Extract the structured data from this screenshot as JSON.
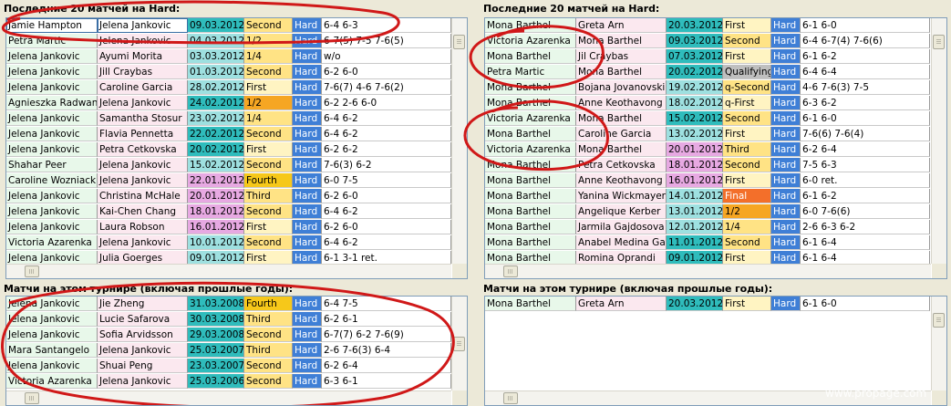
{
  "panels": [
    {
      "title": "Последние 20 матчей на Hard:",
      "rows": [
        {
          "p1": "Jamie Hampton",
          "p2": "Jelena Jankovic",
          "date": "09.03.2012",
          "round": "Second",
          "surface": "Hard",
          "score": "6-4 6-3",
          "c1": "#ffffff",
          "c2": "#ffffff",
          "cd": "#2fbcbc",
          "cr": "#ffe385"
        },
        {
          "p1": "Petra Martic",
          "p2": "Jelena Jankovic",
          "date": "04.03.2012",
          "round": "1/2",
          "surface": "Hard",
          "score": "6-7(5) 7-5 7-6(5)",
          "c1": "#e8f8ea",
          "c2": "#fbe8ef",
          "cd": "#9ee0e0",
          "cr": "#ffe385"
        },
        {
          "p1": "Jelena Jankovic",
          "p2": "Ayumi Morita",
          "date": "03.03.2012",
          "round": "1/4",
          "surface": "Hard",
          "score": "w/o",
          "c1": "#e8f8ea",
          "c2": "#fbe8ef",
          "cd": "#9ee0e0",
          "cr": "#ffe385"
        },
        {
          "p1": "Jelena Jankovic",
          "p2": "Jill Craybas",
          "date": "01.03.2012",
          "round": "Second",
          "surface": "Hard",
          "score": "6-2 6-0",
          "c1": "#e8f8ea",
          "c2": "#fbe8ef",
          "cd": "#9ee0e0",
          "cr": "#ffe385"
        },
        {
          "p1": "Jelena Jankovic",
          "p2": "Caroline Garcia",
          "date": "28.02.2012",
          "round": "First",
          "surface": "Hard",
          "score": "7-6(7) 4-6 7-6(2)",
          "c1": "#e8f8ea",
          "c2": "#fbe8ef",
          "cd": "#9ee0e0",
          "cr": "#fff4c2"
        },
        {
          "p1": "Agnieszka Radwans",
          "p2": "Jelena Jankovic",
          "date": "24.02.2012",
          "round": "1/2",
          "surface": "Hard",
          "score": "6-2 2-6 6-0",
          "c1": "#e8f8ea",
          "c2": "#fbe8ef",
          "cd": "#2fbcbc",
          "cr": "#f6a623"
        },
        {
          "p1": "Jelena Jankovic",
          "p2": "Samantha Stosur",
          "date": "23.02.2012",
          "round": "1/4",
          "surface": "Hard",
          "score": "6-4 6-2",
          "c1": "#e8f8ea",
          "c2": "#fbe8ef",
          "cd": "#9ee0e0",
          "cr": "#ffe385"
        },
        {
          "p1": "Jelena Jankovic",
          "p2": "Flavia Pennetta",
          "date": "22.02.2012",
          "round": "Second",
          "surface": "Hard",
          "score": "6-4 6-2",
          "c1": "#e8f8ea",
          "c2": "#fbe8ef",
          "cd": "#2fbcbc",
          "cr": "#ffe385"
        },
        {
          "p1": "Jelena Jankovic",
          "p2": "Petra Cetkovska",
          "date": "20.02.2012",
          "round": "First",
          "surface": "Hard",
          "score": "6-2 6-2",
          "c1": "#e8f8ea",
          "c2": "#fbe8ef",
          "cd": "#2fbcbc",
          "cr": "#fff4c2"
        },
        {
          "p1": "Shahar Peer",
          "p2": "Jelena Jankovic",
          "date": "15.02.2012",
          "round": "Second",
          "surface": "Hard",
          "score": "7-6(3) 6-2",
          "c1": "#e8f8ea",
          "c2": "#fbe8ef",
          "cd": "#9ee0e0",
          "cr": "#ffe385"
        },
        {
          "p1": "Caroline Wozniacki",
          "p2": "Jelena Jankovic",
          "date": "22.01.2012",
          "round": "Fourth",
          "surface": "Hard",
          "score": "6-0 7-5",
          "c1": "#e8f8ea",
          "c2": "#fbe8ef",
          "cd": "#e7a9e2",
          "cr": "#f6c81a"
        },
        {
          "p1": "Jelena Jankovic",
          "p2": "Christina McHale",
          "date": "20.01.2012",
          "round": "Third",
          "surface": "Hard",
          "score": "6-2 6-0",
          "c1": "#e8f8ea",
          "c2": "#fbe8ef",
          "cd": "#e7a9e2",
          "cr": "#ffe385"
        },
        {
          "p1": "Jelena Jankovic",
          "p2": "Kai-Chen Chang",
          "date": "18.01.2012",
          "round": "Second",
          "surface": "Hard",
          "score": "6-4 6-2",
          "c1": "#e8f8ea",
          "c2": "#fbe8ef",
          "cd": "#e7a9e2",
          "cr": "#ffe385"
        },
        {
          "p1": "Jelena Jankovic",
          "p2": "Laura Robson",
          "date": "16.01.2012",
          "round": "First",
          "surface": "Hard",
          "score": "6-2 6-0",
          "c1": "#e8f8ea",
          "c2": "#fbe8ef",
          "cd": "#e7a9e2",
          "cr": "#fff4c2"
        },
        {
          "p1": "Victoria Azarenka",
          "p2": "Jelena Jankovic",
          "date": "10.01.2012",
          "round": "Second",
          "surface": "Hard",
          "score": "6-4 6-2",
          "c1": "#e8f8ea",
          "c2": "#fbe8ef",
          "cd": "#9ee0e0",
          "cr": "#ffe385"
        },
        {
          "p1": "Jelena Jankovic",
          "p2": "Julia Goerges",
          "date": "09.01.2012",
          "round": "First",
          "surface": "Hard",
          "score": "6-1 3-1 ret.",
          "c1": "#e8f8ea",
          "c2": "#fbe8ef",
          "cd": "#9ee0e0",
          "cr": "#fff4c2"
        }
      ]
    },
    {
      "title": "Последние 20 матчей на Hard:",
      "rows": [
        {
          "p1": "Mona Barthel",
          "p2": "Greta Arn",
          "date": "20.03.2012",
          "round": "First",
          "surface": "Hard",
          "score": "6-1 6-0",
          "c1": "#e8f8ea",
          "c2": "#fbe8ef",
          "cd": "#2fbcbc",
          "cr": "#fff4c2"
        },
        {
          "p1": "Victoria Azarenka",
          "p2": "Mona Barthel",
          "date": "09.03.2012",
          "round": "Second",
          "surface": "Hard",
          "score": "6-4 6-7(4) 7-6(6)",
          "c1": "#e8f8ea",
          "c2": "#fbe8ef",
          "cd": "#2fbcbc",
          "cr": "#ffe385"
        },
        {
          "p1": "Mona Barthel",
          "p2": "Jil Craybas",
          "date": "07.03.2012",
          "round": "First",
          "surface": "Hard",
          "score": "6-1 6-2",
          "c1": "#e8f8ea",
          "c2": "#fbe8ef",
          "cd": "#2fbcbc",
          "cr": "#fff4c2"
        },
        {
          "p1": "Petra Martic",
          "p2": "Mona Barthel",
          "date": "20.02.2012",
          "round": "Qualifying",
          "surface": "Hard",
          "score": "6-4 6-4",
          "c1": "#e8f8ea",
          "c2": "#fbe8ef",
          "cd": "#2fbcbc",
          "cr": "#bfbfbf"
        },
        {
          "p1": "Mona Barthel",
          "p2": "Bojana Jovanovski",
          "date": "19.02.2012",
          "round": "q-Second",
          "surface": "Hard",
          "score": "4-6 7-6(3) 7-5",
          "c1": "#e8f8ea",
          "c2": "#fbe8ef",
          "cd": "#9ee0e0",
          "cr": "#ffe385"
        },
        {
          "p1": "Mona Barthel",
          "p2": "Anne Keothavong",
          "date": "18.02.2012",
          "round": "q-First",
          "surface": "Hard",
          "score": "6-3 6-2",
          "c1": "#e8f8ea",
          "c2": "#fbe8ef",
          "cd": "#9ee0e0",
          "cr": "#fff4c2"
        },
        {
          "p1": "Victoria Azarenka",
          "p2": "Mona Barthel",
          "date": "15.02.2012",
          "round": "Second",
          "surface": "Hard",
          "score": "6-1 6-0",
          "c1": "#e8f8ea",
          "c2": "#fbe8ef",
          "cd": "#2fbcbc",
          "cr": "#ffe385"
        },
        {
          "p1": "Mona Barthel",
          "p2": "Caroline Garcia",
          "date": "13.02.2012",
          "round": "First",
          "surface": "Hard",
          "score": "7-6(6) 7-6(4)",
          "c1": "#e8f8ea",
          "c2": "#fbe8ef",
          "cd": "#9ee0e0",
          "cr": "#fff4c2"
        },
        {
          "p1": "Victoria Azarenka",
          "p2": "Mona Barthel",
          "date": "20.01.2012",
          "round": "Third",
          "surface": "Hard",
          "score": "6-2 6-4",
          "c1": "#e8f8ea",
          "c2": "#fbe8ef",
          "cd": "#e7a9e2",
          "cr": "#ffe385"
        },
        {
          "p1": "Mona Barthel",
          "p2": "Petra Cetkovska",
          "date": "18.01.2012",
          "round": "Second",
          "surface": "Hard",
          "score": "7-5 6-3",
          "c1": "#e8f8ea",
          "c2": "#fbe8ef",
          "cd": "#e7a9e2",
          "cr": "#ffe385"
        },
        {
          "p1": "Mona Barthel",
          "p2": "Anne Keothavong",
          "date": "16.01.2012",
          "round": "First",
          "surface": "Hard",
          "score": "6-0 ret.",
          "c1": "#e8f8ea",
          "c2": "#fbe8ef",
          "cd": "#e7a9e2",
          "cr": "#fff4c2"
        },
        {
          "p1": "Mona Barthel",
          "p2": "Yanina Wickmayer",
          "date": "14.01.2012",
          "round": "Final",
          "surface": "Hard",
          "score": "6-1 6-2",
          "c1": "#e8f8ea",
          "c2": "#fbe8ef",
          "cd": "#9ee0e0",
          "cr": "#f36f2a"
        },
        {
          "p1": "Mona Barthel",
          "p2": "Angelique Kerber",
          "date": "13.01.2012",
          "round": "1/2",
          "surface": "Hard",
          "score": "6-0 7-6(6)",
          "c1": "#e8f8ea",
          "c2": "#fbe8ef",
          "cd": "#9ee0e0",
          "cr": "#f6a623"
        },
        {
          "p1": "Mona Barthel",
          "p2": "Jarmila Gajdosova",
          "date": "12.01.2012",
          "round": "1/4",
          "surface": "Hard",
          "score": "2-6 6-3 6-2",
          "c1": "#e8f8ea",
          "c2": "#fbe8ef",
          "cd": "#9ee0e0",
          "cr": "#ffe385"
        },
        {
          "p1": "Mona Barthel",
          "p2": "Anabel Medina Garri",
          "date": "11.01.2012",
          "round": "Second",
          "surface": "Hard",
          "score": "6-1 6-4",
          "c1": "#e8f8ea",
          "c2": "#fbe8ef",
          "cd": "#2fbcbc",
          "cr": "#ffe385"
        },
        {
          "p1": "Mona Barthel",
          "p2": "Romina Oprandi",
          "date": "09.01.2012",
          "round": "First",
          "surface": "Hard",
          "score": "6-1 6-4",
          "c1": "#e8f8ea",
          "c2": "#fbe8ef",
          "cd": "#2fbcbc",
          "cr": "#fff4c2"
        }
      ]
    },
    {
      "title": "Матчи на этом турнире (включая прошлые годы):",
      "rows": [
        {
          "p1": "Jelena Jankovic",
          "p2": "Jie Zheng",
          "date": "31.03.2008",
          "round": "Fourth",
          "surface": "Hard",
          "score": "6-4 7-5",
          "c1": "#e8f8ea",
          "c2": "#fbe8ef",
          "cd": "#2fbcbc",
          "cr": "#f6c81a"
        },
        {
          "p1": "Jelena Jankovic",
          "p2": "Lucie Safarova",
          "date": "30.03.2008",
          "round": "Third",
          "surface": "Hard",
          "score": "6-2 6-1",
          "c1": "#e8f8ea",
          "c2": "#fbe8ef",
          "cd": "#2fbcbc",
          "cr": "#ffe385"
        },
        {
          "p1": "Jelena Jankovic",
          "p2": "Sofia Arvidsson",
          "date": "29.03.2008",
          "round": "Second",
          "surface": "Hard",
          "score": "6-7(7) 6-2 7-6(9)",
          "c1": "#e8f8ea",
          "c2": "#fbe8ef",
          "cd": "#2fbcbc",
          "cr": "#ffe385"
        },
        {
          "p1": "Mara Santangelo",
          "p2": "Jelena Jankovic",
          "date": "25.03.2007",
          "round": "Third",
          "surface": "Hard",
          "score": "2-6 7-6(3) 6-4",
          "c1": "#e8f8ea",
          "c2": "#fbe8ef",
          "cd": "#2fbcbc",
          "cr": "#ffe385"
        },
        {
          "p1": "Jelena Jankovic",
          "p2": "Shuai Peng",
          "date": "23.03.2007",
          "round": "Second",
          "surface": "Hard",
          "score": "6-2 6-4",
          "c1": "#e8f8ea",
          "c2": "#fbe8ef",
          "cd": "#2fbcbc",
          "cr": "#ffe385"
        },
        {
          "p1": "Victoria Azarenka",
          "p2": "Jelena Jankovic",
          "date": "25.03.2006",
          "round": "Second",
          "surface": "Hard",
          "score": "6-3 6-1",
          "c1": "#e8f8ea",
          "c2": "#fbe8ef",
          "cd": "#2fbcbc",
          "cr": "#ffe385"
        }
      ]
    },
    {
      "title": "Матчи на этом турнире (включая прошлые годы):",
      "rows": [
        {
          "p1": "Mona Barthel",
          "p2": "Greta Arn",
          "date": "20.03.2012",
          "round": "First",
          "surface": "Hard",
          "score": "6-1 6-0",
          "c1": "#e8f8ea",
          "c2": "#fbe8ef",
          "cd": "#2fbcbc",
          "cr": "#fff4c2"
        }
      ]
    }
  ],
  "colors": {
    "hard": "#3f7fd6",
    "annotation": "#d01818",
    "selected_outline": "#3a6ea5"
  },
  "watermark": "www.propage.com"
}
